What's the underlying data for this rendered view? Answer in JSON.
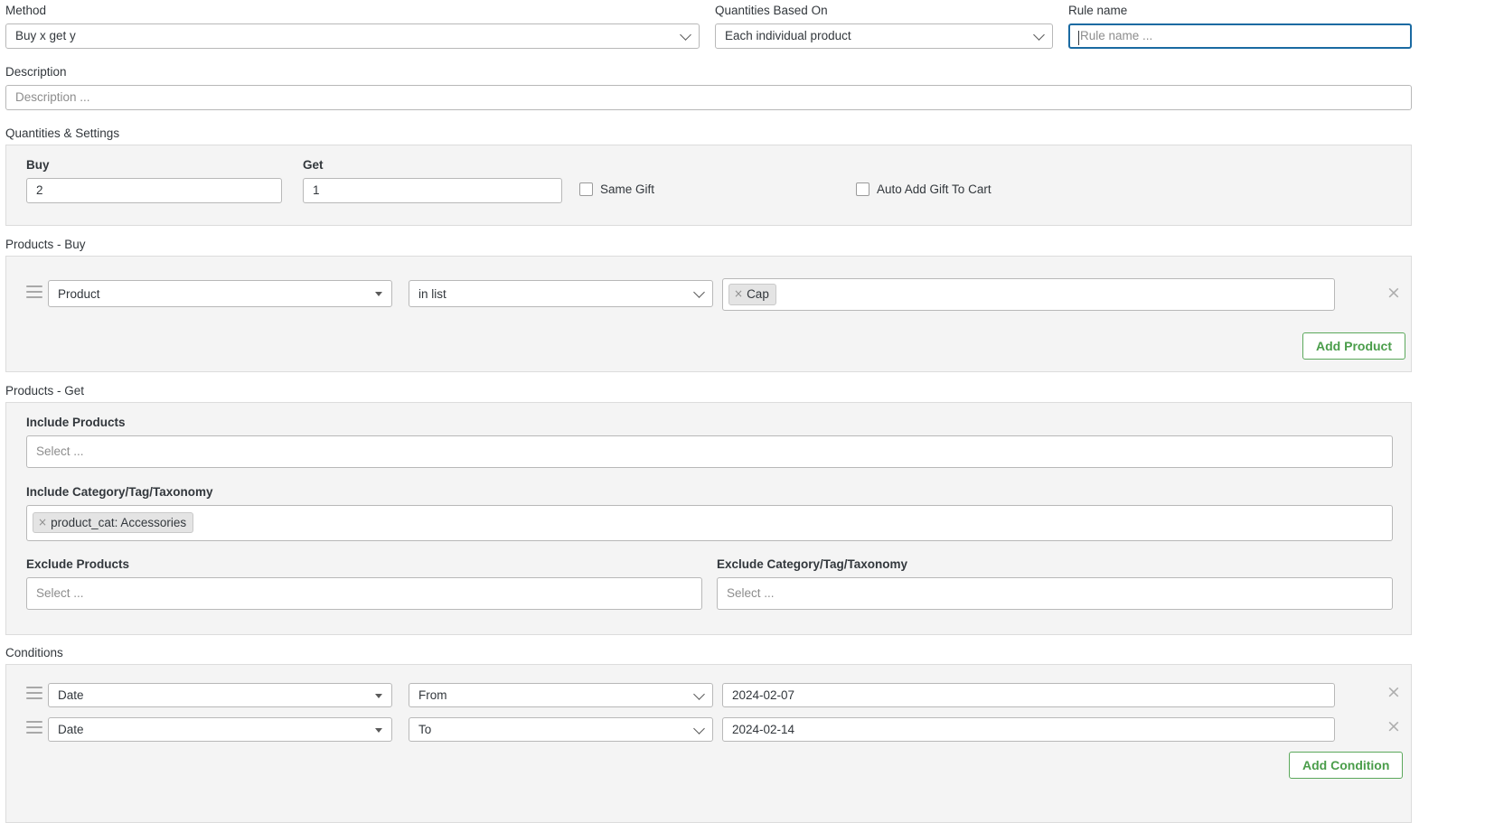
{
  "method": {
    "label": "Method",
    "value": "Buy x get y"
  },
  "quantities_based_on": {
    "label": "Quantities Based On",
    "value": "Each individual product"
  },
  "rule_name": {
    "label": "Rule name",
    "value": "",
    "placeholder": "Rule name ..."
  },
  "description": {
    "label": "Description",
    "value": "",
    "placeholder": "Description ..."
  },
  "quantities_settings": {
    "section_label": "Quantities & Settings",
    "buy": {
      "label": "Buy",
      "value": "2"
    },
    "get": {
      "label": "Get",
      "value": "1"
    },
    "same_gift": {
      "label": "Same Gift",
      "checked": false
    },
    "auto_add_gift": {
      "label": "Auto Add Gift To Cart",
      "checked": false
    }
  },
  "products_buy": {
    "section_label": "Products - Buy",
    "rows": [
      {
        "type": "Product",
        "operator": "in list",
        "tags": [
          "Cap"
        ]
      }
    ],
    "add_button": "Add Product"
  },
  "products_get": {
    "section_label": "Products - Get",
    "include_products": {
      "label": "Include Products",
      "placeholder": "Select ...",
      "tags": []
    },
    "include_category": {
      "label": "Include Category/Tag/Taxonomy",
      "placeholder": "Select ...",
      "tags": [
        "product_cat: Accessories"
      ]
    },
    "exclude_products": {
      "label": "Exclude Products",
      "placeholder": "Select ...",
      "tags": []
    },
    "exclude_category": {
      "label": "Exclude Category/Tag/Taxonomy",
      "placeholder": "Select ...",
      "tags": []
    }
  },
  "conditions": {
    "section_label": "Conditions",
    "rows": [
      {
        "type": "Date",
        "operator": "From",
        "value": "2024-02-07"
      },
      {
        "type": "Date",
        "operator": "To",
        "value": "2024-02-14"
      }
    ],
    "add_button": "Add Condition"
  },
  "colors": {
    "accent_green": "#4a9d4a",
    "focus_blue": "#1a6aa2",
    "panel_bg": "#f4f4f4",
    "border": "#b8b8b8"
  },
  "icons": {
    "drag_handle": "drag-handle-icon",
    "remove": "close-icon",
    "chevron": "chevron-down-icon",
    "triangle": "triangle-down-icon"
  }
}
